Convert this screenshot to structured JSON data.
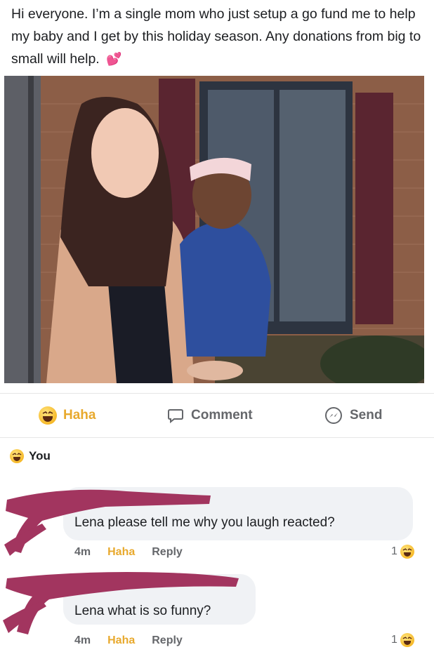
{
  "post": {
    "text": "Hi everyone. I’m a single mom who just setup a go fund me to help my baby and I get by this holiday season. Any donations from big to small will help.",
    "emoji_icon": "heart-emoji-icon"
  },
  "actions": {
    "haha_label": "Haha",
    "comment_label": "Comment",
    "send_label": "Send"
  },
  "viewer_reaction": {
    "name": "You",
    "icon": "haha-emoji-icon"
  },
  "comments": [
    {
      "text": "Lena please tell me why you laugh reacted?",
      "time": "4m",
      "haha_label": "Haha",
      "reply_label": "Reply",
      "reaction_count": "1"
    },
    {
      "text": "Lena what is so funny?",
      "time": "4m",
      "haha_label": "Haha",
      "reply_label": "Reply",
      "reaction_count": "1"
    }
  ],
  "colors": {
    "haha_yellow": "#e8a92d",
    "muted_text": "#65676b",
    "bubble_bg": "#f0f2f5",
    "redaction": "#a2355f"
  }
}
